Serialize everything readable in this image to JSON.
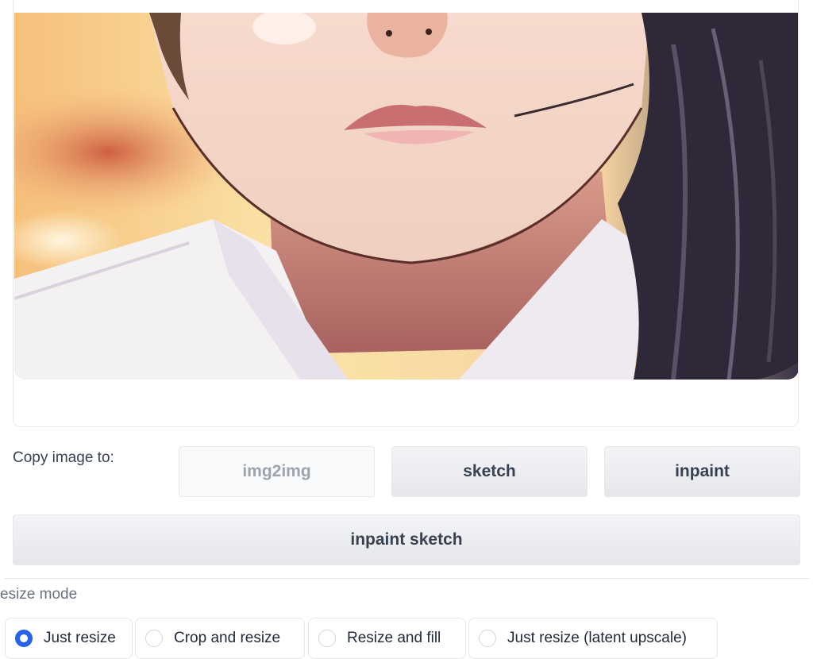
{
  "copy_section": {
    "label": "Copy image to:",
    "buttons": [
      {
        "label": "img2img",
        "disabled": true
      },
      {
        "label": "sketch",
        "disabled": false
      },
      {
        "label": "inpaint",
        "disabled": false
      }
    ],
    "wide_button": "inpaint sketch"
  },
  "resize_mode": {
    "label": "esize mode",
    "options": [
      {
        "label": "Just resize",
        "checked": true
      },
      {
        "label": "Crop and resize",
        "checked": false
      },
      {
        "label": "Resize and fill",
        "checked": false
      },
      {
        "label": "Just resize (latent upscale)",
        "checked": false
      }
    ]
  },
  "colors": {
    "accent": "#2563eb",
    "button_bg": "#e5e7eb",
    "border": "#e5e7eb"
  }
}
